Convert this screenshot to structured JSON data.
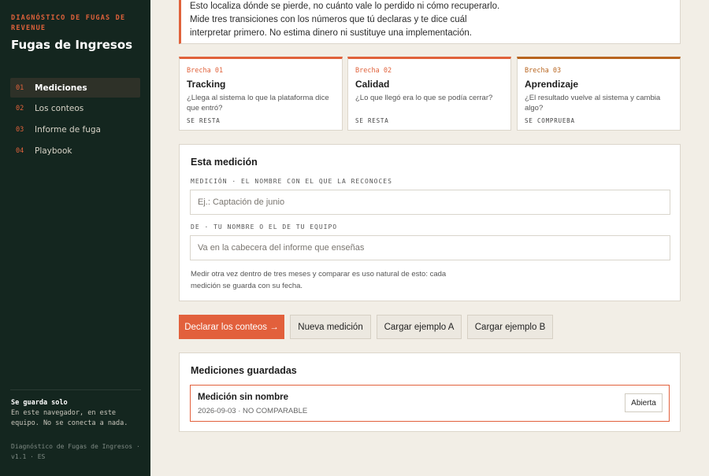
{
  "sidebar": {
    "kicker": "DIAGNÓSTICO DE FUGAS DE REVENUE",
    "title": "Fugas de Ingresos",
    "nav": [
      {
        "num": "01",
        "label": "Mediciones",
        "active": true
      },
      {
        "num": "02",
        "label": "Los conteos",
        "active": false
      },
      {
        "num": "03",
        "label": "Informe de fuga",
        "active": false
      },
      {
        "num": "04",
        "label": "Playbook",
        "active": false
      }
    ],
    "save_title": "Se guarda solo",
    "save_text": "En este navegador, en este equipo. No se conecta a nada.",
    "version": "Diagnóstico de Fugas de Ingresos · v1.1 · ES"
  },
  "intro": {
    "text": "Esto localiza dónde se pierde, no cuánto vale lo perdido ni cómo recuperarlo. Mide tres transiciones con los números que tú declaras y te dice cuál interpretar primero. No estima dinero ni sustituye una implementación."
  },
  "cards": [
    {
      "kicker": "Brecha 01",
      "title": "Tracking",
      "desc": "¿Llega al sistema lo que la plataforma dice que entró?",
      "tag": "SE RESTA",
      "accent": "#e0623b"
    },
    {
      "kicker": "Brecha 02",
      "title": "Calidad",
      "desc": "¿Lo que llegó era lo que se podía cerrar?",
      "tag": "SE RESTA",
      "accent": "#e0623b"
    },
    {
      "kicker": "Brecha 03",
      "title": "Aprendizaje",
      "desc": "¿El resultado vuelve al sistema y cambia algo?",
      "tag": "SE COMPRUEBA",
      "accent": "#b8651f"
    }
  ],
  "form": {
    "title": "Esta medición",
    "medicion_label": "MEDICIÓN · EL NOMBRE CON EL QUE LA RECONOCES",
    "medicion_placeholder": "Ej.: Captación de junio",
    "de_label": "DE · TU NOMBRE O EL DE TU EQUIPO",
    "de_placeholder": "Va en la cabecera del informe que enseñas",
    "note": "Medir otra vez dentro de tres meses y comparar es uso natural de esto: cada medición se guarda con su fecha."
  },
  "actions": {
    "primary": "Declarar los conteos →",
    "new": "Nueva medición",
    "load_a": "Cargar ejemplo A",
    "load_b": "Cargar ejemplo B"
  },
  "saved": {
    "title": "Mediciones guardadas",
    "items": [
      {
        "name": "Medición sin nombre",
        "meta": "2026-09-03 · NO COMPARABLE",
        "button": "Abierta"
      }
    ]
  }
}
